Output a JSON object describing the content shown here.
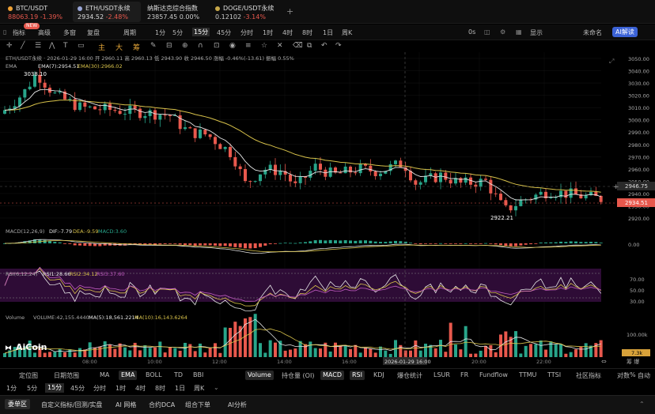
{
  "tabs": [
    {
      "name": "BTC/USDT",
      "price": "88063.19",
      "change": "-1.39%",
      "color": "#e8584d"
    },
    {
      "name": "ETH/USDT永续",
      "price": "2934.52",
      "change": "-2.48%",
      "color": "#e8584d"
    },
    {
      "name": "纳斯达克综合指数",
      "price": "23857.45",
      "change": "0.00%",
      "color": "#cfcfcf"
    },
    {
      "name": "DOGE/USDT永续",
      "price": "0.12102",
      "change": "-3.14%",
      "color": "#e8584d"
    }
  ],
  "toolbar": {
    "new_badge": "NEW",
    "items": [
      "指标",
      "高级",
      "多窗",
      "复盘",
      "周期",
      "1分",
      "5分",
      "15分",
      "45分",
      "分时",
      "1时",
      "4时",
      "8时",
      "1日",
      "周K"
    ],
    "right": [
      "0s",
      "显示",
      "未命名"
    ],
    "ai_label": "AI解读"
  },
  "draw_tools": [
    "主",
    "大",
    "筹"
  ],
  "chart": {
    "title_line": "ETH/USDT永续 · 2026-01-29 16:00 开 2960.11 高 2960.13 低 2943.90 收 2946.50 涨幅 -0.46%(-13.61) 振幅 0.55%",
    "ema_label": "EMA",
    "ema7": "EMA(7):2954.51",
    "ema30": "EMA(30):2966.02",
    "high_label": "3038.10",
    "low_label": "2922.21",
    "price_ticks": [
      "3050.00",
      "3040.00",
      "3030.00",
      "3020.00",
      "3010.00",
      "3000.00",
      "2990.00",
      "2980.00",
      "2970.00",
      "2960.00",
      "2950.00",
      "2940.00",
      "2930.00",
      "2920.00"
    ],
    "crosshair_price": "2946.75",
    "last_price": "2934.51",
    "macd_label": "MACD(12,26,9)",
    "dif": "DIF:-7.79",
    "dea": "DEA:-9.59",
    "macd": "MACD:3.60",
    "macd_tick": "0.00",
    "rsi_label": "RSI(6,12,24)",
    "rsi1": "RSI1:28.66",
    "rsi2": "RSI2:34.12",
    "rsi3": "RSI3:37.60",
    "rsi_ticks": [
      "70.00",
      "50.00",
      "30.00"
    ],
    "vol_label": "Volume",
    "vol_value": "VOLUME:42,155.4440",
    "ma5": "MA(5):18,561.2214",
    "ma10": "MA(10):16,143.6264",
    "vol_tick": "100.00k",
    "vol_last": "7.3k",
    "time_ticks": [
      "08:00",
      "10:00",
      "12:00",
      "14:00",
      "16:00",
      "18:00",
      "20:00",
      "22:00"
    ],
    "time_highlight": "2026-01-29 16:00",
    "watermark": "AiCoin",
    "colors": {
      "up": "#28a58a",
      "down": "#e8584d",
      "ema7": "#e6e6e6",
      "ema30": "#d8c24a"
    }
  },
  "indicators": {
    "left": [
      "定位图",
      "日期范围"
    ],
    "main": [
      "MA",
      "EMA",
      "BOLL",
      "TD",
      "BBI"
    ],
    "sub": [
      "Volume",
      "持仓量 (OI)",
      "MACD",
      "RSI",
      "KDJ",
      "爆仓统计",
      "LSUR",
      "FR",
      "Fundflow",
      "TTMU",
      "TTSI",
      "社区指标"
    ],
    "right": [
      "对数",
      "%",
      "自动"
    ]
  },
  "timeframes": [
    "1分",
    "5分",
    "15分",
    "45分",
    "分时",
    "1时",
    "4时",
    "8时",
    "1日",
    "周K"
  ],
  "bottom": [
    "委单区",
    "自定义指标/回测/实盘",
    "AI 网格",
    "合约DCA",
    "组合下单",
    "AI分析"
  ]
}
